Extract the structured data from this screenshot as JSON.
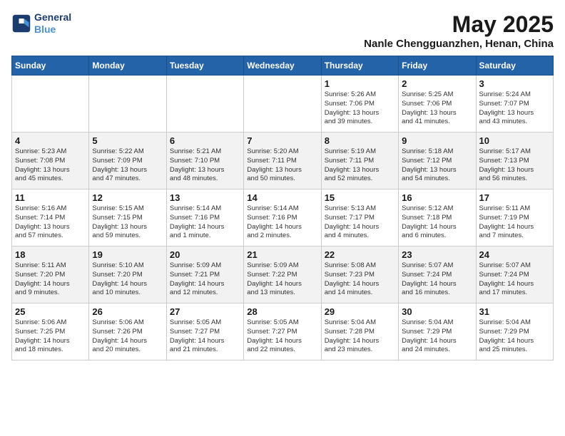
{
  "logo": {
    "line1": "General",
    "line2": "Blue"
  },
  "title": "May 2025",
  "location": "Nanle Chengguanzhen, Henan, China",
  "weekdays": [
    "Sunday",
    "Monday",
    "Tuesday",
    "Wednesday",
    "Thursday",
    "Friday",
    "Saturday"
  ],
  "weeks": [
    [
      {
        "num": "",
        "info": ""
      },
      {
        "num": "",
        "info": ""
      },
      {
        "num": "",
        "info": ""
      },
      {
        "num": "",
        "info": ""
      },
      {
        "num": "1",
        "info": "Sunrise: 5:26 AM\nSunset: 7:06 PM\nDaylight: 13 hours\nand 39 minutes."
      },
      {
        "num": "2",
        "info": "Sunrise: 5:25 AM\nSunset: 7:06 PM\nDaylight: 13 hours\nand 41 minutes."
      },
      {
        "num": "3",
        "info": "Sunrise: 5:24 AM\nSunset: 7:07 PM\nDaylight: 13 hours\nand 43 minutes."
      }
    ],
    [
      {
        "num": "4",
        "info": "Sunrise: 5:23 AM\nSunset: 7:08 PM\nDaylight: 13 hours\nand 45 minutes."
      },
      {
        "num": "5",
        "info": "Sunrise: 5:22 AM\nSunset: 7:09 PM\nDaylight: 13 hours\nand 47 minutes."
      },
      {
        "num": "6",
        "info": "Sunrise: 5:21 AM\nSunset: 7:10 PM\nDaylight: 13 hours\nand 48 minutes."
      },
      {
        "num": "7",
        "info": "Sunrise: 5:20 AM\nSunset: 7:11 PM\nDaylight: 13 hours\nand 50 minutes."
      },
      {
        "num": "8",
        "info": "Sunrise: 5:19 AM\nSunset: 7:11 PM\nDaylight: 13 hours\nand 52 minutes."
      },
      {
        "num": "9",
        "info": "Sunrise: 5:18 AM\nSunset: 7:12 PM\nDaylight: 13 hours\nand 54 minutes."
      },
      {
        "num": "10",
        "info": "Sunrise: 5:17 AM\nSunset: 7:13 PM\nDaylight: 13 hours\nand 56 minutes."
      }
    ],
    [
      {
        "num": "11",
        "info": "Sunrise: 5:16 AM\nSunset: 7:14 PM\nDaylight: 13 hours\nand 57 minutes."
      },
      {
        "num": "12",
        "info": "Sunrise: 5:15 AM\nSunset: 7:15 PM\nDaylight: 13 hours\nand 59 minutes."
      },
      {
        "num": "13",
        "info": "Sunrise: 5:14 AM\nSunset: 7:16 PM\nDaylight: 14 hours\nand 1 minute."
      },
      {
        "num": "14",
        "info": "Sunrise: 5:14 AM\nSunset: 7:16 PM\nDaylight: 14 hours\nand 2 minutes."
      },
      {
        "num": "15",
        "info": "Sunrise: 5:13 AM\nSunset: 7:17 PM\nDaylight: 14 hours\nand 4 minutes."
      },
      {
        "num": "16",
        "info": "Sunrise: 5:12 AM\nSunset: 7:18 PM\nDaylight: 14 hours\nand 6 minutes."
      },
      {
        "num": "17",
        "info": "Sunrise: 5:11 AM\nSunset: 7:19 PM\nDaylight: 14 hours\nand 7 minutes."
      }
    ],
    [
      {
        "num": "18",
        "info": "Sunrise: 5:11 AM\nSunset: 7:20 PM\nDaylight: 14 hours\nand 9 minutes."
      },
      {
        "num": "19",
        "info": "Sunrise: 5:10 AM\nSunset: 7:20 PM\nDaylight: 14 hours\nand 10 minutes."
      },
      {
        "num": "20",
        "info": "Sunrise: 5:09 AM\nSunset: 7:21 PM\nDaylight: 14 hours\nand 12 minutes."
      },
      {
        "num": "21",
        "info": "Sunrise: 5:09 AM\nSunset: 7:22 PM\nDaylight: 14 hours\nand 13 minutes."
      },
      {
        "num": "22",
        "info": "Sunrise: 5:08 AM\nSunset: 7:23 PM\nDaylight: 14 hours\nand 14 minutes."
      },
      {
        "num": "23",
        "info": "Sunrise: 5:07 AM\nSunset: 7:24 PM\nDaylight: 14 hours\nand 16 minutes."
      },
      {
        "num": "24",
        "info": "Sunrise: 5:07 AM\nSunset: 7:24 PM\nDaylight: 14 hours\nand 17 minutes."
      }
    ],
    [
      {
        "num": "25",
        "info": "Sunrise: 5:06 AM\nSunset: 7:25 PM\nDaylight: 14 hours\nand 18 minutes."
      },
      {
        "num": "26",
        "info": "Sunrise: 5:06 AM\nSunset: 7:26 PM\nDaylight: 14 hours\nand 20 minutes."
      },
      {
        "num": "27",
        "info": "Sunrise: 5:05 AM\nSunset: 7:27 PM\nDaylight: 14 hours\nand 21 minutes."
      },
      {
        "num": "28",
        "info": "Sunrise: 5:05 AM\nSunset: 7:27 PM\nDaylight: 14 hours\nand 22 minutes."
      },
      {
        "num": "29",
        "info": "Sunrise: 5:04 AM\nSunset: 7:28 PM\nDaylight: 14 hours\nand 23 minutes."
      },
      {
        "num": "30",
        "info": "Sunrise: 5:04 AM\nSunset: 7:29 PM\nDaylight: 14 hours\nand 24 minutes."
      },
      {
        "num": "31",
        "info": "Sunrise: 5:04 AM\nSunset: 7:29 PM\nDaylight: 14 hours\nand 25 minutes."
      }
    ]
  ]
}
